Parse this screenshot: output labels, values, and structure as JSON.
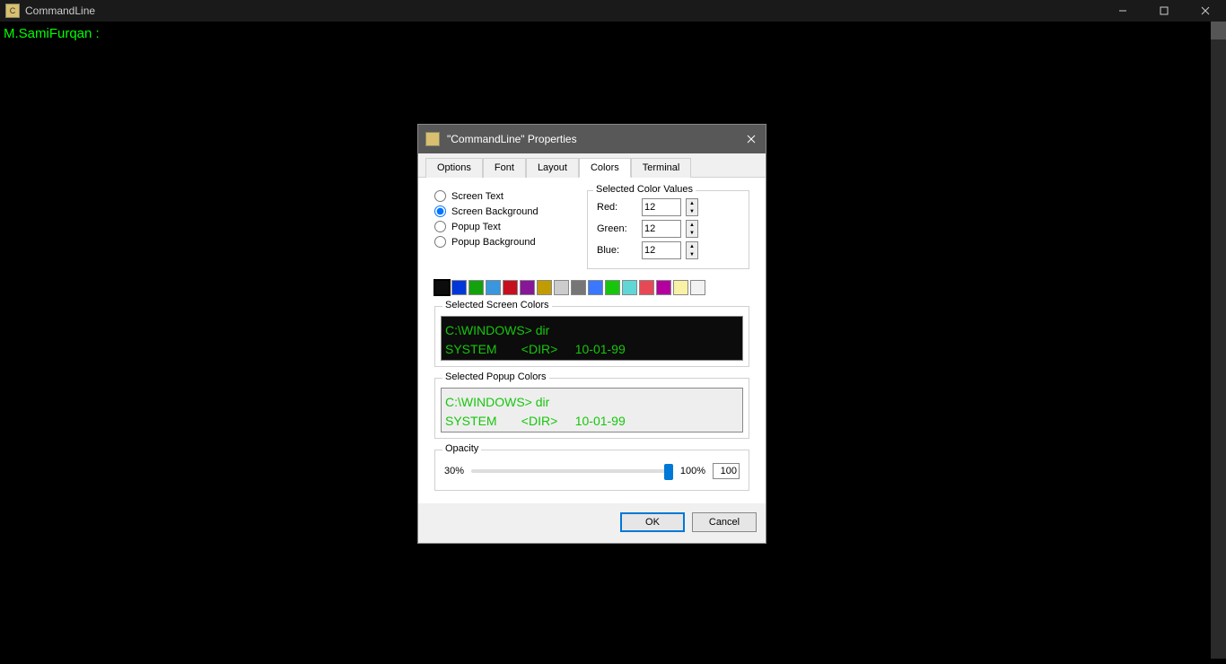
{
  "window": {
    "title": "CommandLine"
  },
  "terminal": {
    "prompt": "M.SamiFurqan :"
  },
  "dialog": {
    "title": "\"CommandLine\" Properties",
    "tabs": [
      "Options",
      "Font",
      "Layout",
      "Colors",
      "Terminal"
    ],
    "active_tab": "Colors",
    "radios": {
      "screen_text": "Screen Text",
      "screen_background": "Screen Background",
      "popup_text": "Popup Text",
      "popup_background": "Popup Background",
      "selected": "screen_background"
    },
    "color_values": {
      "legend": "Selected Color Values",
      "red_label": "Red:",
      "green_label": "Green:",
      "blue_label": "Blue:",
      "red": "12",
      "green": "12",
      "blue": "12"
    },
    "palette": [
      "#0c0c0c",
      "#0037da",
      "#13a10e",
      "#3a96dd",
      "#c50f1f",
      "#881798",
      "#c19c00",
      "#cccccc",
      "#767676",
      "#3b78ff",
      "#16c60c",
      "#61d6d6",
      "#e74856",
      "#b4009e",
      "#f9f1a5",
      "#f2f2f2"
    ],
    "palette_selected_index": 0,
    "preview_screen": {
      "legend": "Selected Screen Colors",
      "line1": "C:\\WINDOWS> dir",
      "line2": "SYSTEM       <DIR>     10-01-99"
    },
    "preview_popup": {
      "legend": "Selected Popup Colors",
      "line1": "C:\\WINDOWS> dir",
      "line2": "SYSTEM       <DIR>     10-01-99"
    },
    "opacity": {
      "legend": "Opacity",
      "min_label": "30%",
      "max_label": "100%",
      "value": "100"
    },
    "buttons": {
      "ok": "OK",
      "cancel": "Cancel"
    }
  }
}
